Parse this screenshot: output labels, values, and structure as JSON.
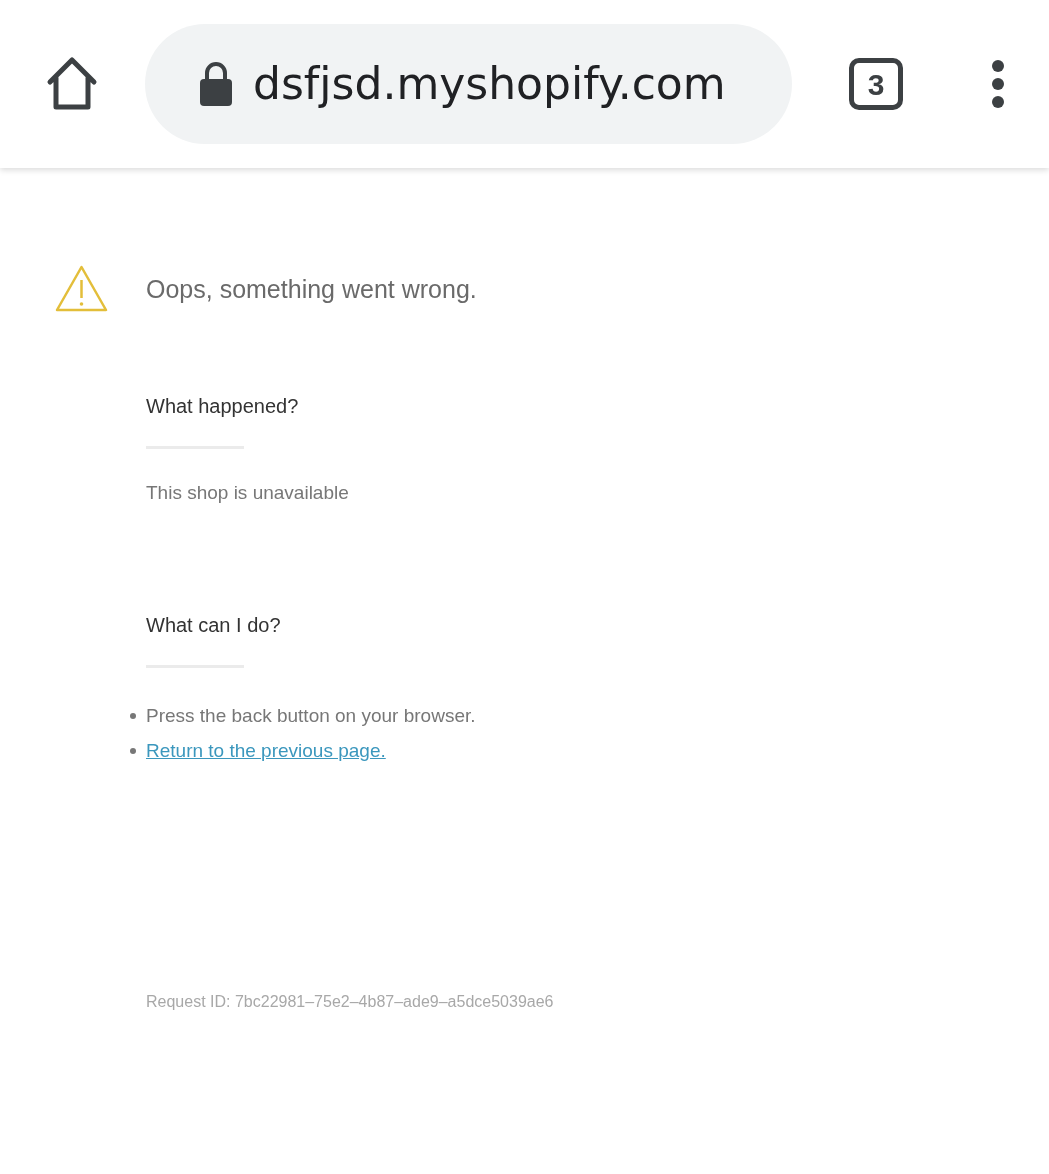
{
  "toolbar": {
    "url": "dsfjsd.myshopify.com",
    "tab_count": "3"
  },
  "error": {
    "title": "Oops, something went wrong."
  },
  "sections": [
    {
      "heading": "What happened?",
      "kind": "text",
      "text": "This shop is unavailable"
    },
    {
      "heading": "What can I do?",
      "kind": "list",
      "items": [
        {
          "text": "Press the back button on your browser.",
          "link": false
        },
        {
          "text": "Return to the previous page.",
          "link": true
        }
      ]
    }
  ],
  "request_id": "Request ID: 7bc22981–75e2–4b87–ade9–a5dce5039ae6"
}
